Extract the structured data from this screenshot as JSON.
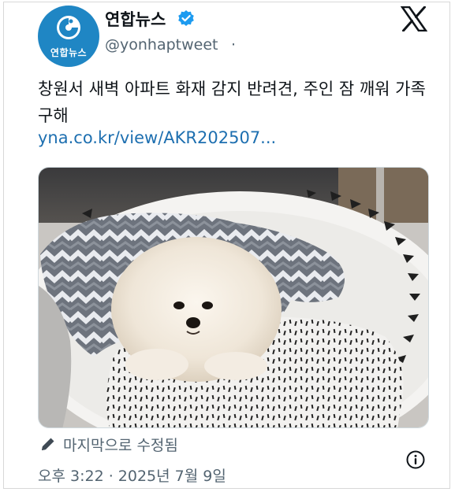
{
  "account": {
    "display_name": "연합뉴스",
    "handle": "@yonhaptweet",
    "handle_separator": "·",
    "avatar_text": "연합뉴스",
    "verified": true,
    "brand_color": "#1f86c4",
    "verified_color": "#1d9bf0"
  },
  "platform": {
    "icon": "x-logo-icon"
  },
  "tweet": {
    "text": "창원서 새벽 아파트 화재 감지 반려견, 주인 잠 깨워 가족 구해",
    "link": "yna.co.kr/view/AKR202507...",
    "link_color": "#1d6fb0"
  },
  "media": {
    "icon": "photo-image",
    "subject": "dog-on-bed-photo"
  },
  "footer": {
    "edited_label": "마지막으로 수정됨",
    "edited_icon": "pencil-icon",
    "timestamp": "오후 3:22 · 2025년 7월 9일",
    "info_icon": "info-icon"
  }
}
